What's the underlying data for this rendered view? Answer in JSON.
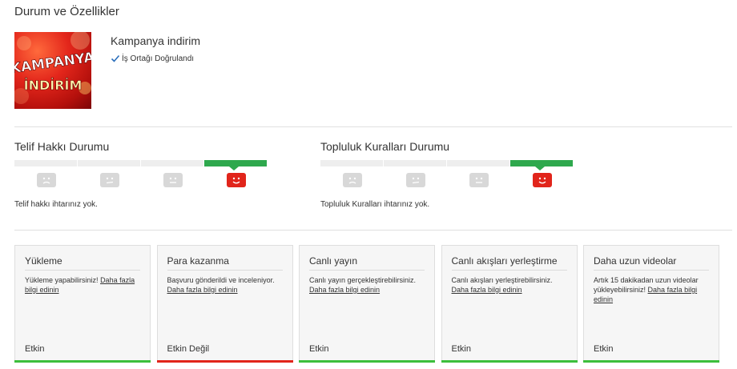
{
  "page": {
    "title": "Durum ve Özellikler"
  },
  "channel": {
    "thumbnail_text_line1": "KAMPANYA",
    "thumbnail_text_line2": "İNDİRİM",
    "name": "Kampanya indirim",
    "verified_label": "İş Ortağı Doğrulandı"
  },
  "copyright_status": {
    "title": "Telif Hakkı Durumu",
    "note": "Telif hakkı ihtarınız yok.",
    "active_level": 4,
    "levels": [
      "sad-face-icon",
      "frown-face-icon",
      "neutral-face-icon",
      "happy-face-icon"
    ]
  },
  "community_status": {
    "title": "Topluluk Kuralları Durumu",
    "note": "Topluluk Kuralları ihtarınız yok.",
    "active_level": 4,
    "levels": [
      "sad-face-icon",
      "frown-face-icon",
      "neutral-face-icon",
      "happy-face-icon"
    ]
  },
  "colors": {
    "ok": "#3cbf3c",
    "bad": "#e1251b",
    "active_bar": "#2ea84d",
    "inactive": "#d8d8d8"
  },
  "features": [
    {
      "title": "Yükleme",
      "desc": "Yükleme yapabilirsiniz!",
      "link": "Daha fazla bilgi edinin",
      "status": "Etkin",
      "state": "ok"
    },
    {
      "title": "Para kazanma",
      "desc": "Başvuru gönderildi ve inceleniyor.",
      "link": "Daha fazla bilgi edinin",
      "status": "Etkin Değil",
      "state": "bad"
    },
    {
      "title": "Canlı yayın",
      "desc": "Canlı yayın gerçekleştirebilirsiniz.",
      "link": "Daha fazla bilgi edinin",
      "status": "Etkin",
      "state": "ok"
    },
    {
      "title": "Canlı akışları yerleştirme",
      "desc": "Canlı akışları yerleştirebilirsiniz.",
      "link": "Daha fazla bilgi edinin",
      "status": "Etkin",
      "state": "ok"
    },
    {
      "title": "Daha uzun videolar",
      "desc": "Artık 15 dakikadan uzun videolar yükleyebilirsiniz!",
      "link": "Daha fazla bilgi edinin",
      "status": "Etkin",
      "state": "ok"
    }
  ]
}
